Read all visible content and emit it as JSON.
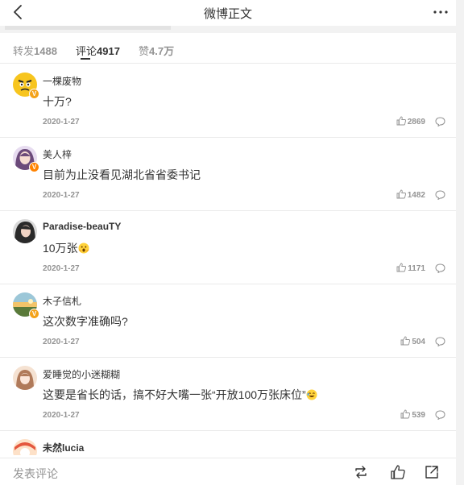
{
  "header": {
    "title": "微博正文"
  },
  "tabs": [
    {
      "label": "转发",
      "count": "1488"
    },
    {
      "label": "评论",
      "count": "4917"
    },
    {
      "label": "赞",
      "count": "4.7万"
    }
  ],
  "comments": [
    {
      "username": "一棵废物",
      "text": "十万?",
      "date": "2020-1-27",
      "likes": "2869"
    },
    {
      "username": "美人梓",
      "text": "目前为止没看见湖北省省委书记",
      "date": "2020-1-27",
      "likes": "1482"
    },
    {
      "username": "Paradise-beauTY",
      "text": "10万张",
      "date": "2020-1-27",
      "likes": "1171",
      "emoji": "wow-emoji"
    },
    {
      "username": "木子信札",
      "text": "这次数字准确吗?",
      "date": "2020-1-27",
      "likes": "504"
    },
    {
      "username": "爱睡觉的小迷糊糊",
      "text": "这要是省长的话，搞不好大嘴一张“开放100万张床位”",
      "date": "2020-1-27",
      "likes": "539",
      "emoji": "laugh-emoji"
    },
    {
      "username": "未然lucia"
    }
  ],
  "bottom": {
    "post_comment": "发表评论"
  },
  "colors": {
    "text": "#333333",
    "muted": "#939393",
    "divider": "#eaeaea",
    "badge_yellow": "#f4a219",
    "badge_orange": "#ff8200"
  },
  "icons": [
    "back-icon",
    "more-icon",
    "like-icon",
    "reply-icon",
    "repost-icon",
    "thumb-up-icon",
    "share-icon"
  ]
}
